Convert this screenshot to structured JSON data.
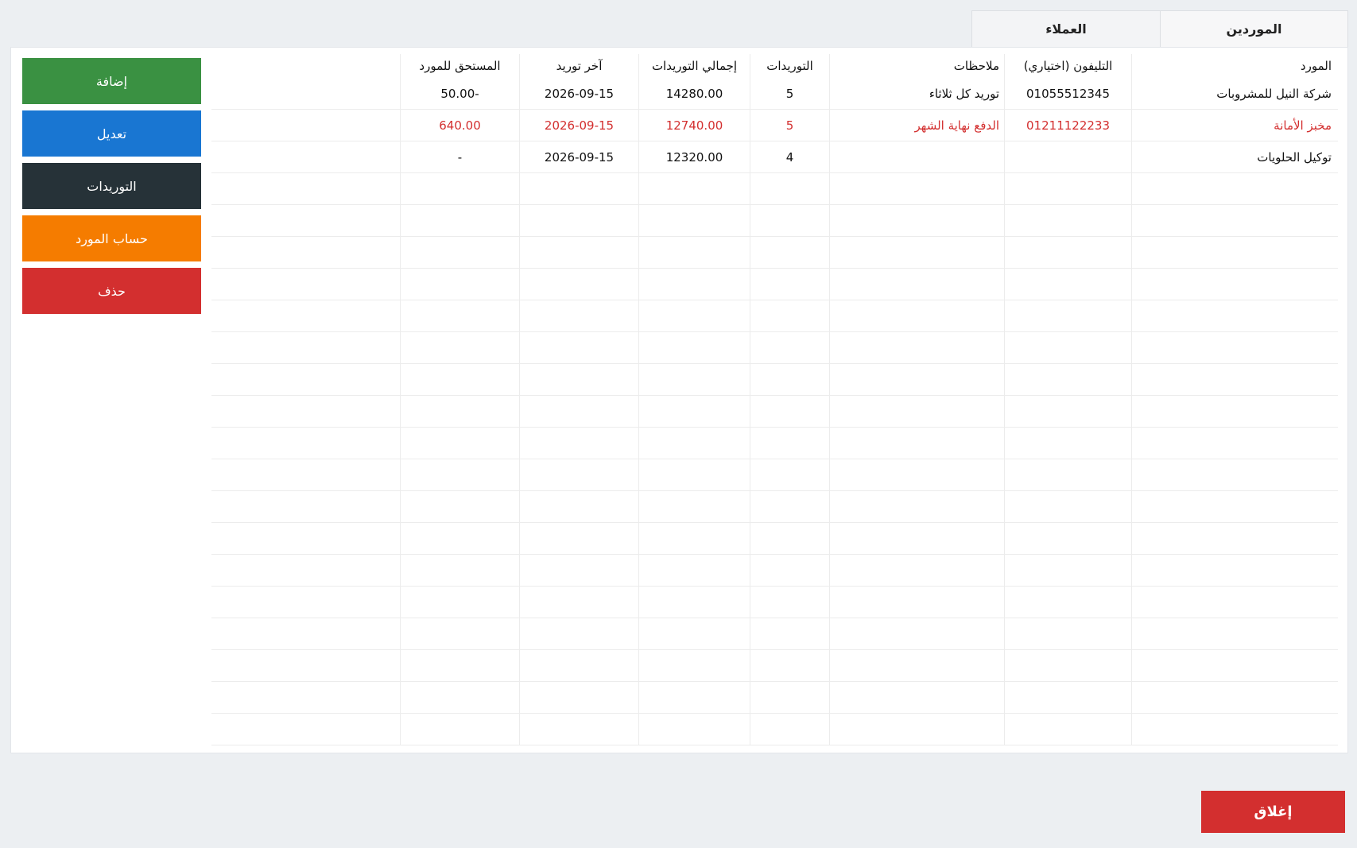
{
  "tabs": [
    {
      "label": "الموردين",
      "active": true
    },
    {
      "label": "العملاء",
      "active": false
    }
  ],
  "actions": {
    "add": {
      "label": "إضافة",
      "color": "#3a9142"
    },
    "edit": {
      "label": "تعديل",
      "color": "#1976d2"
    },
    "supplies": {
      "label": "التوريدات",
      "color": "#263238"
    },
    "account": {
      "label": "حساب المورد",
      "color": "#f57c00"
    },
    "delete": {
      "label": "حذف",
      "color": "#d32f2f"
    }
  },
  "table": {
    "columns": [
      "المورد",
      "التليفون (اختياري)",
      "ملاحظات",
      "التوريدات",
      "إجمالي التوريدات",
      "آخر توريد",
      "المستحق للمورد"
    ],
    "rows": [
      {
        "name": "شركة النيل للمشروبات",
        "phone": "01055512345",
        "notes": "توريد كل ثلاثاء",
        "count": "5",
        "total": "14280.00",
        "last": "2026-09-15",
        "due": "-50.00",
        "highlight": false
      },
      {
        "name": "مخبز الأمانة",
        "phone": "01211122233",
        "notes": "الدفع نهاية الشهر",
        "count": "5",
        "total": "12740.00",
        "last": "2026-09-15",
        "due": "640.00",
        "highlight": true
      },
      {
        "name": "توكيل الحلويات",
        "phone": "",
        "notes": "",
        "count": "4",
        "total": "12320.00",
        "last": "2026-09-15",
        "due": "-",
        "highlight": false
      }
    ]
  },
  "footer": {
    "close_label": "إغلاق"
  }
}
